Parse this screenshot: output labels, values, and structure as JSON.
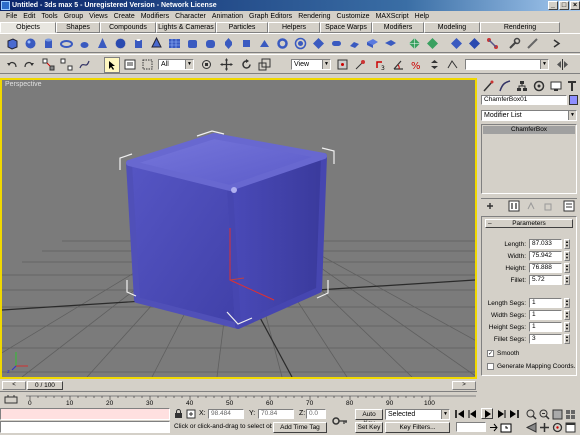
{
  "window": {
    "title": "Untitled - 3ds max 5 - Unregistered Version - Network License"
  },
  "menu": [
    "File",
    "Edit",
    "Tools",
    "Group",
    "Views",
    "Create",
    "Modifiers",
    "Character",
    "Animation",
    "Graph Editors",
    "Rendering",
    "Customize",
    "MAXScript",
    "Help"
  ],
  "tabs": [
    "Objects",
    "Shapes",
    "Compounds",
    "Lights & Cameras",
    "Particles",
    "Helpers",
    "Space Warps",
    "Modifiers",
    "Modeling",
    "Rendering"
  ],
  "toolbar": {
    "selection_filter": "All",
    "reference_coord": "View"
  },
  "viewport": {
    "label": "Perspective",
    "colors": {
      "box_front": "#5a5ac8",
      "box_side": "#4848b0",
      "box_top": "#7070d8",
      "border_active": "#f0d800",
      "grid": "#5a5a5a"
    }
  },
  "command_panel": {
    "object_name": "ChamferBox01",
    "modifier_list_label": "Modifier List",
    "stack_item": "ChamferBox",
    "rollout_title": "Parameters",
    "params": [
      {
        "label": "Length:",
        "value": "87.033"
      },
      {
        "label": "Width:",
        "value": "75.942"
      },
      {
        "label": "Height:",
        "value": "76.888"
      },
      {
        "label": "Fillet:",
        "value": "5.72"
      }
    ],
    "segs": [
      {
        "label": "Length Segs:",
        "value": "1"
      },
      {
        "label": "Width Segs:",
        "value": "1"
      },
      {
        "label": "Height Segs:",
        "value": "1"
      },
      {
        "label": "Fillet Segs:",
        "value": "3"
      }
    ],
    "smooth_label": "Smooth",
    "smooth_checked": true,
    "gen_map_label": "Generate Mapping Coords.",
    "gen_map_checked": false
  },
  "time": {
    "slider_label": "0 / 100",
    "ticks": [
      "0",
      "10",
      "20",
      "30",
      "40",
      "50",
      "60",
      "70",
      "80",
      "90",
      "100"
    ]
  },
  "status": {
    "prompt": "Click or click-and-drag to select ob",
    "add_time_tag": "Add Time Tag",
    "x_label": "X:",
    "x_value": "98.484",
    "y_label": "Y:",
    "y_value": "70.84",
    "z_label": "Z:",
    "z_value": "0.0",
    "auto_key": "Auto Key",
    "set_key": "Set Key",
    "key_mode": "Selected",
    "key_filters": "Key Filters..."
  }
}
